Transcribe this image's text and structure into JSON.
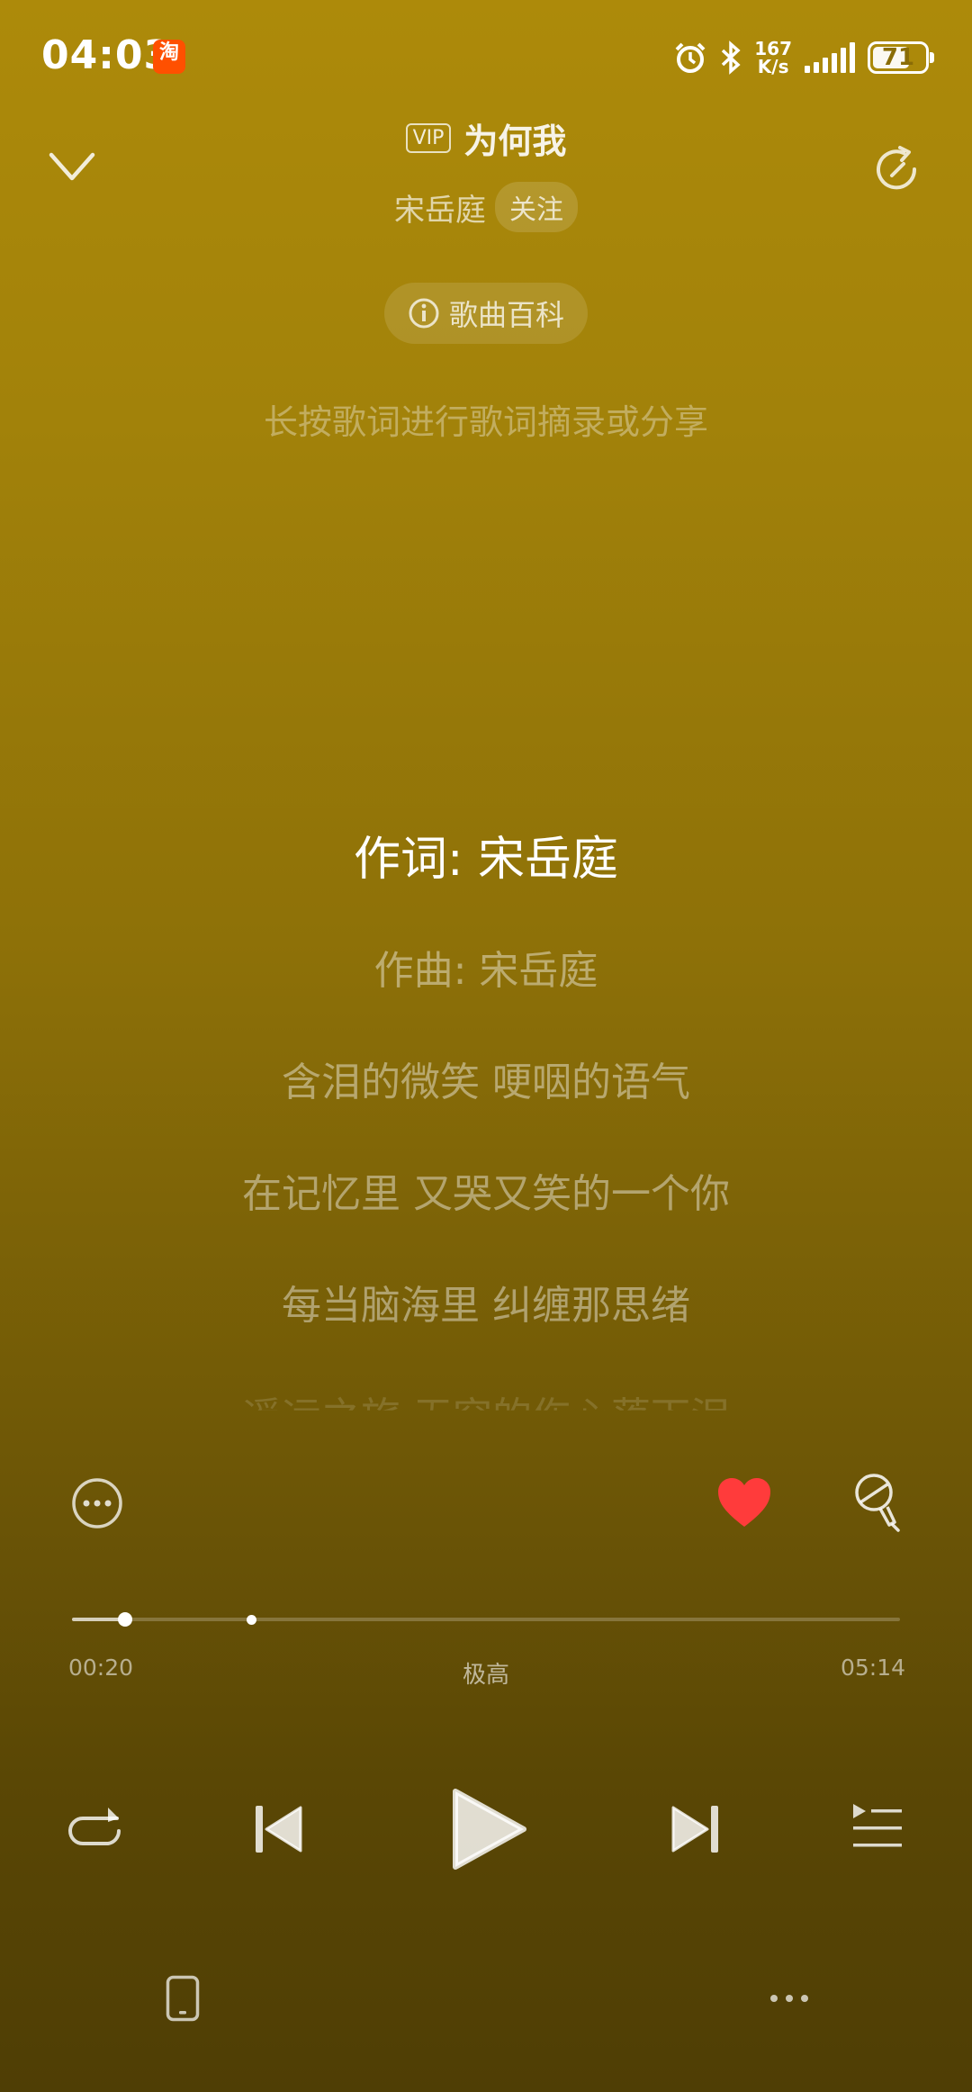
{
  "status_bar": {
    "time": "04:03",
    "app_badge": "淘",
    "net_speed_value": "167",
    "net_speed_unit": "K/s",
    "battery": "71",
    "battery_level": 0.71
  },
  "header": {
    "vip_badge": "VIP",
    "song_title": "为何我",
    "artist": "宋岳庭",
    "follow_label": "关注",
    "wiki_label": "歌曲百科",
    "hint": "长按歌词进行歌词摘录或分享"
  },
  "lyrics": [
    {
      "text": "作词: 宋岳庭",
      "state": "active"
    },
    {
      "text": "作曲: 宋岳庭",
      "state": "normal"
    },
    {
      "text": "含泪的微笑 哽咽的语气",
      "state": "normal"
    },
    {
      "text": "在记忆里 又哭又笑的一个你",
      "state": "normal"
    },
    {
      "text": "每当脑海里 纠缠那思绪",
      "state": "normal"
    },
    {
      "text": "遥远之旅 无穷的伤心落下泪",
      "state": "fade"
    }
  ],
  "player": {
    "current_time": "00:20",
    "total_time": "05:14",
    "quality": "极高",
    "progress": 0.064,
    "buffered": 0.21,
    "liked": true
  },
  "icons": {
    "collapse": "chevron-down-icon",
    "share": "refresh-icon",
    "more": "more-icon",
    "like": "heart-icon",
    "karaoke": "microphone-icon",
    "repeat": "repeat-icon",
    "prev": "previous-icon",
    "play": "play-icon",
    "next": "next-icon",
    "playlist": "playlist-icon",
    "device": "device-icon",
    "menu": "menu-dots-icon"
  },
  "colors": {
    "background_top": "#ad8a0a",
    "background_bottom": "#4f3e05",
    "like": "#ff3b3b"
  }
}
